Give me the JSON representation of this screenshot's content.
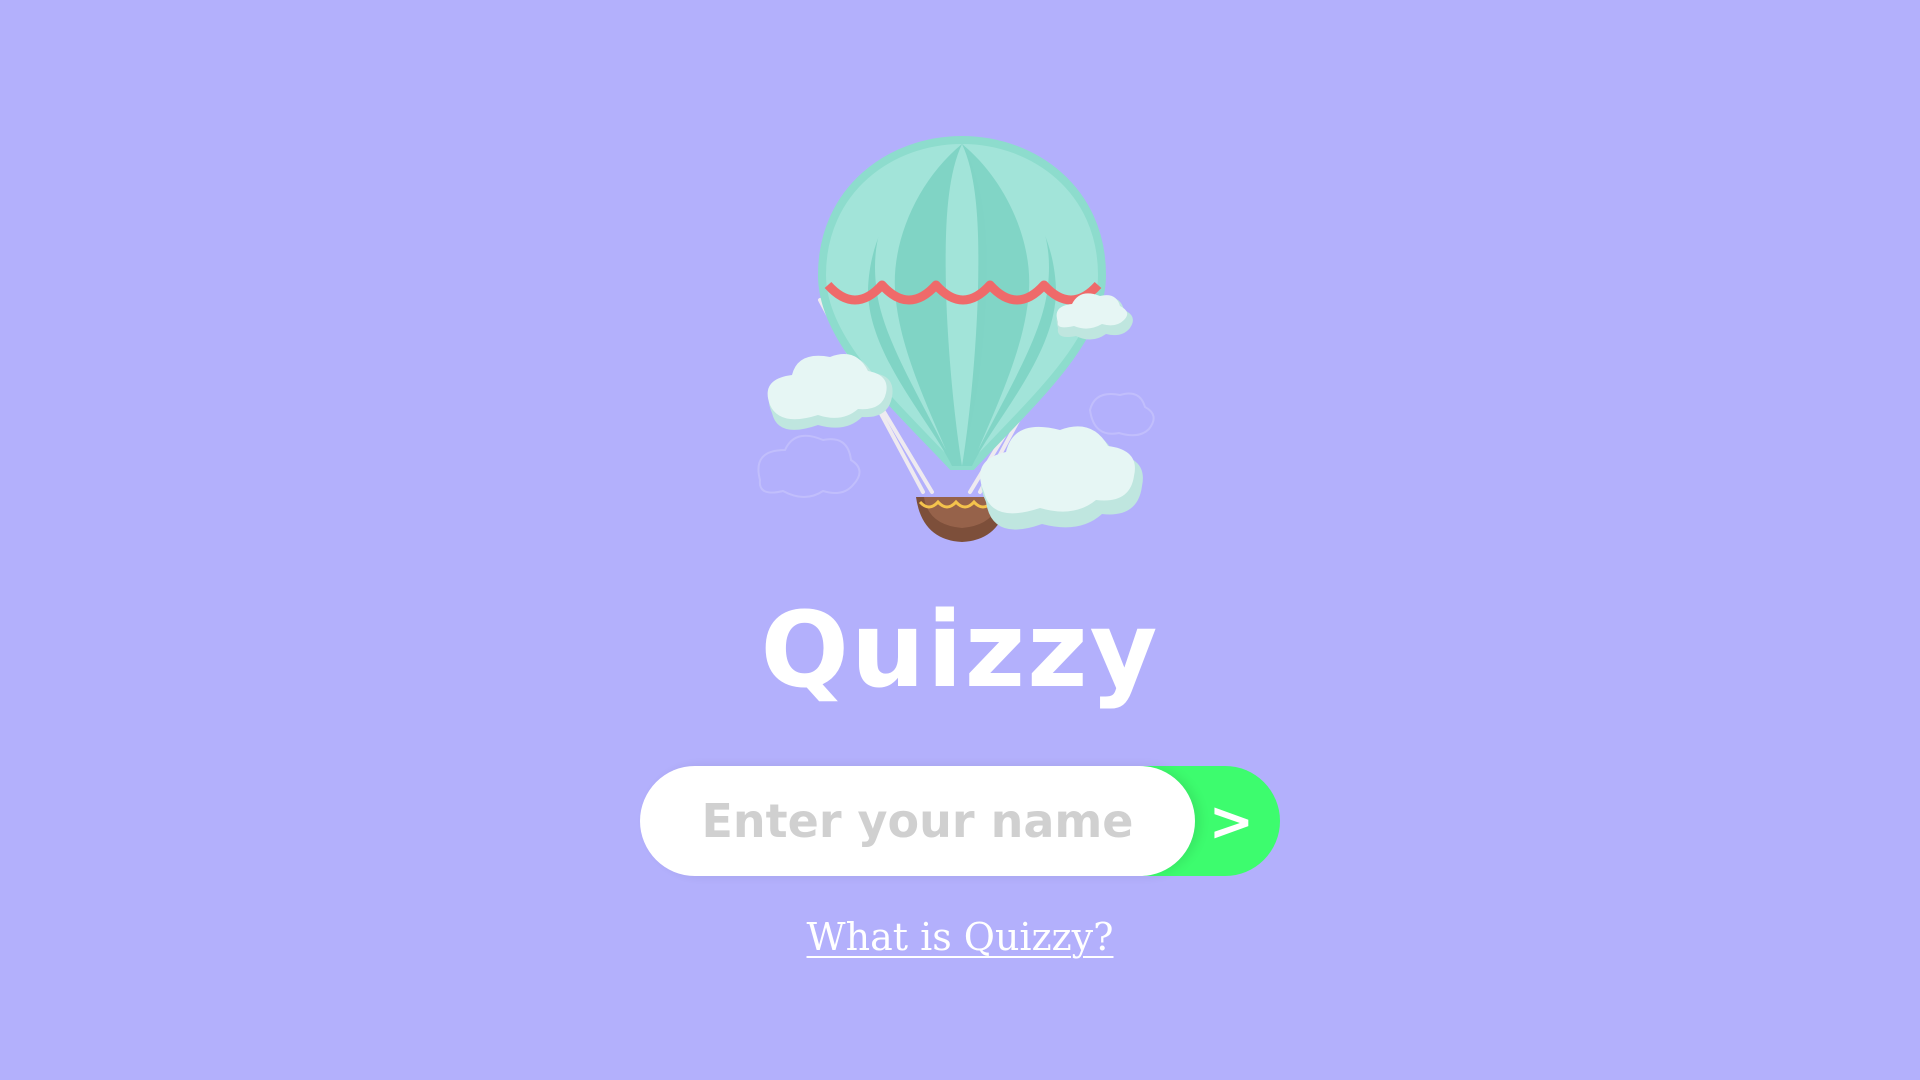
{
  "app": {
    "title": "Quizzy"
  },
  "hero": {
    "image": "hot-air-balloon-illustration"
  },
  "form": {
    "name_placeholder": "Enter your name",
    "name_value": "",
    "submit_label": ">"
  },
  "links": {
    "about": "What is Quizzy?"
  },
  "colors": {
    "background": "#b3b0fc",
    "submit": "#3dfc6e",
    "balloon_light": "#a2e4d9",
    "balloon_dark": "#80d4c5",
    "balloon_trim": "#ef6a6a",
    "basket": "#7d4f3a",
    "cloud": "#e6f6f4"
  }
}
